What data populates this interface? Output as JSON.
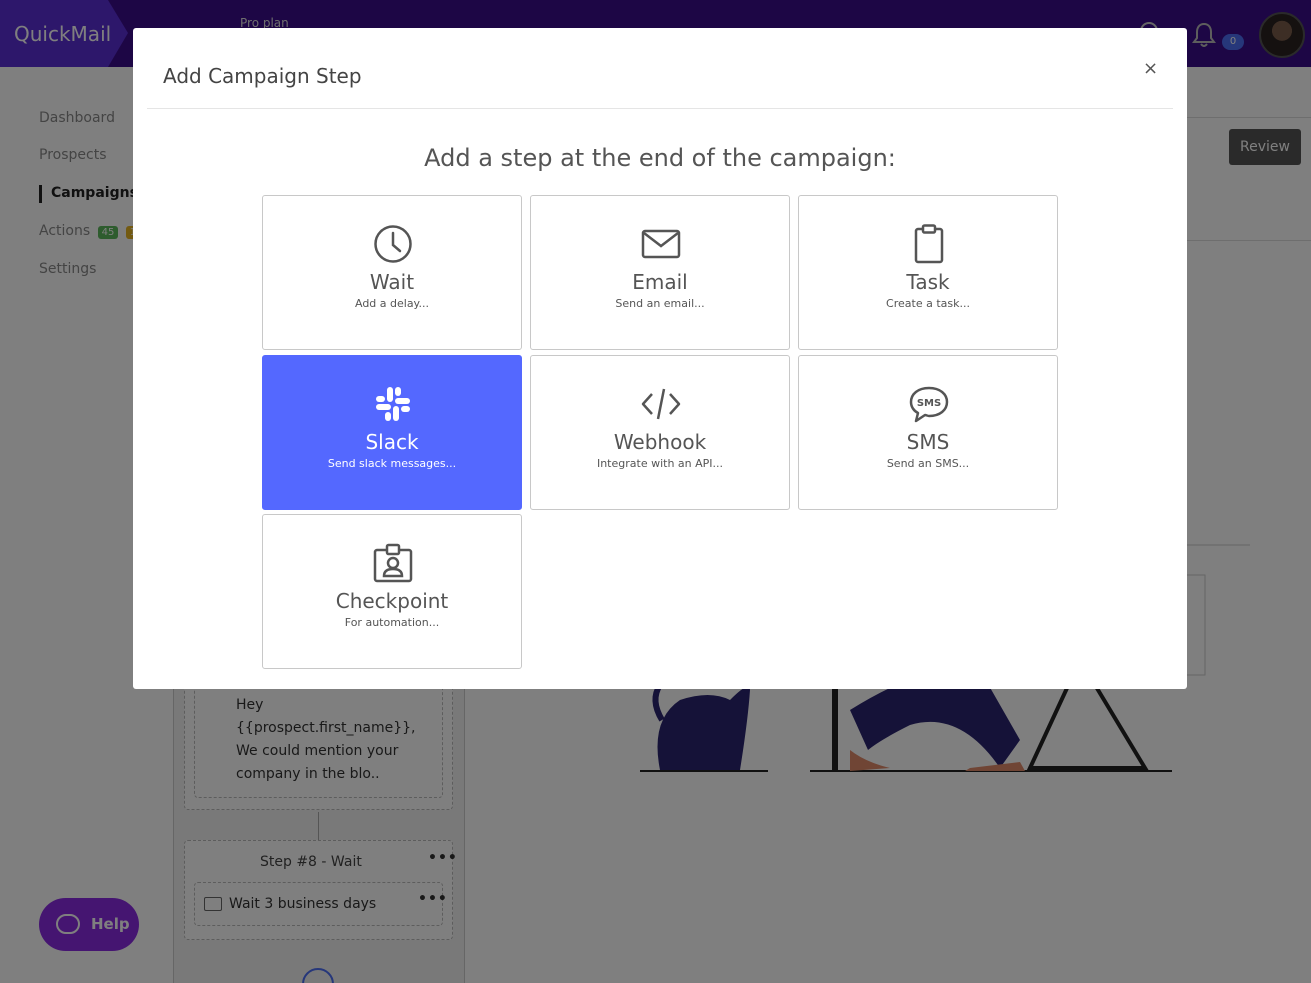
{
  "app": {
    "logo": "QuickMail",
    "plan": "Pro plan",
    "notification_count": "0"
  },
  "sidebar": {
    "items": [
      {
        "label": "Dashboard"
      },
      {
        "label": "Prospects"
      },
      {
        "label": "Campaigns"
      },
      {
        "label": "Actions"
      },
      {
        "label": "Settings"
      }
    ],
    "actions_badges": [
      "45",
      "1"
    ]
  },
  "page": {
    "review_label": "Review"
  },
  "campaign": {
    "email_preview": "Hey {{prospect.first_name}}, We could mention your company in the blo..",
    "step8_title": "Step #8 - Wait",
    "step8_wait": "Wait 3 business days",
    "more_dots": "•••"
  },
  "help": {
    "label": "Help"
  },
  "modal": {
    "title": "Add Campaign Step",
    "close": "×",
    "heading": "Add a step at the end of the campaign:",
    "tiles": [
      {
        "label": "Wait",
        "desc": "Add a delay...",
        "icon": "clock-icon"
      },
      {
        "label": "Email",
        "desc": "Send an email...",
        "icon": "envelope-icon"
      },
      {
        "label": "Task",
        "desc": "Create a task...",
        "icon": "clipboard-icon"
      },
      {
        "label": "Slack",
        "desc": "Send slack messages...",
        "icon": "slack-icon",
        "selected": true
      },
      {
        "label": "Webhook",
        "desc": "Integrate with an API...",
        "icon": "code-icon"
      },
      {
        "label": "SMS",
        "desc": "Send an SMS...",
        "icon": "sms-bubble-icon"
      },
      {
        "label": "Checkpoint",
        "desc": "For automation...",
        "icon": "id-badge-icon"
      }
    ],
    "sms_icon_text": "SMS"
  },
  "colors": {
    "topbar": "#3a0d8a",
    "selected_tile": "#5468ff",
    "help_button": "#8a2be2"
  }
}
